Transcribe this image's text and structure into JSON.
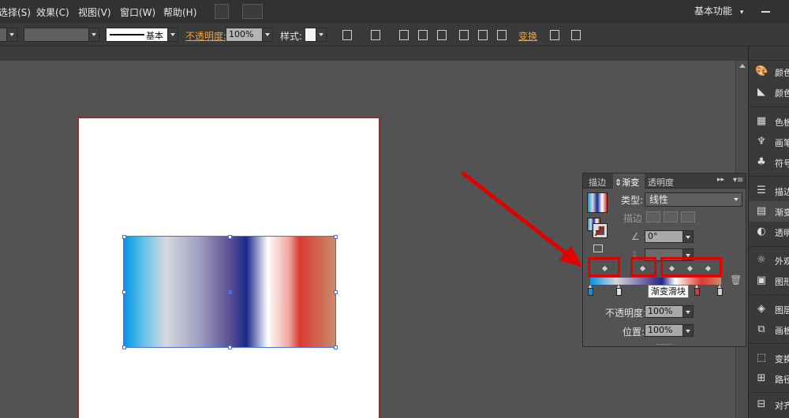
{
  "menubar": {
    "items": [
      "选择(S)",
      "效果(C)",
      "视图(V)",
      "窗口(W)",
      "帮助(H)"
    ],
    "workspace_label": "基本功能"
  },
  "control_bar": {
    "stroke_weight_label": "基本",
    "opacity_label": "不透明度:",
    "opacity_value": "100%",
    "style_label": "样式:",
    "transform_label": "变换"
  },
  "dock": {
    "items": [
      {
        "icon": "palette-icon",
        "label": "颜色"
      },
      {
        "icon": "color-guide-icon",
        "label": "颜色"
      },
      {
        "icon": "swatches-icon",
        "label": "色板"
      },
      {
        "icon": "brush-icon",
        "label": "画笔"
      },
      {
        "icon": "symbol-icon",
        "label": "符号"
      },
      {
        "icon": "stroke-icon",
        "label": "描边"
      },
      {
        "icon": "gradient-icon",
        "label": "渐变"
      },
      {
        "icon": "transparency-icon",
        "label": "透明"
      },
      {
        "icon": "appearance-icon",
        "label": "外观"
      },
      {
        "icon": "graphic-styles-icon",
        "label": "图形"
      },
      {
        "icon": "layers-icon",
        "label": "图层"
      },
      {
        "icon": "artboards-icon",
        "label": "画板"
      },
      {
        "icon": "transform-icon",
        "label": "变换"
      },
      {
        "icon": "pathfinder-icon",
        "label": "路径"
      },
      {
        "icon": "align-icon",
        "label": "对齐"
      }
    ]
  },
  "gradient_panel": {
    "tabs": [
      "描边",
      "渐变",
      "透明度"
    ],
    "active_tab": "渐变",
    "type_label": "类型:",
    "type_value": "线性",
    "stroke_label": "描边",
    "angle_value": "0°",
    "opacity_label": "不透明度:",
    "opacity_value": "100%",
    "location_label": "位置:",
    "location_value": "100%",
    "tooltip": "渐变滑块",
    "stop_colors": [
      "#1a8fd0",
      "#e0e0e0",
      "#d03a30",
      "#d0d0d0"
    ]
  },
  "colors": {
    "annotation": "#e00000",
    "gradient_stops": [
      "#0096e0",
      "#d6d8de",
      "#5b5295",
      "#1c2a8a",
      "#ffffff",
      "#d83a30",
      "#c88c6e"
    ]
  }
}
